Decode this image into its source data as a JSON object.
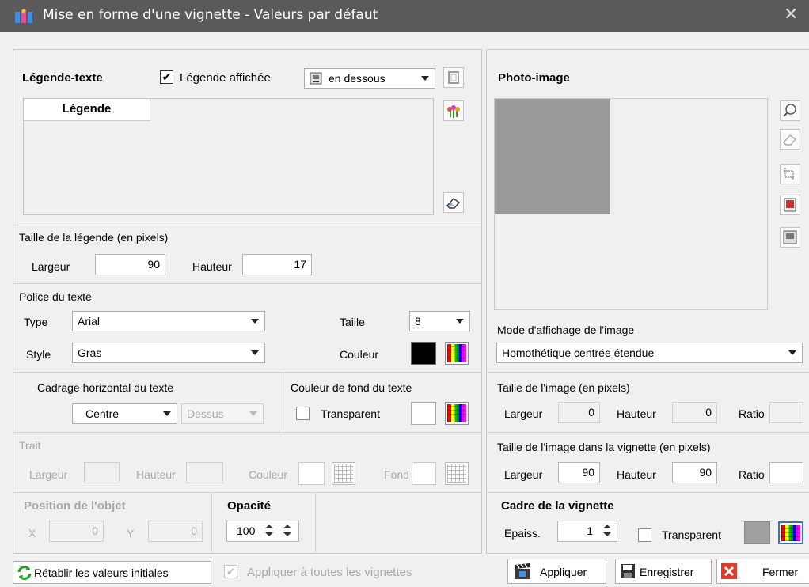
{
  "window": {
    "title": "Mise en forme d'une vignette - Valeurs par défaut",
    "close": "✕"
  },
  "legend": {
    "section_title": "Légende-texte",
    "shown_label": "Légende affichée",
    "shown_checked": true,
    "position_value": "en dessous",
    "text_header": "Légende"
  },
  "legend_size": {
    "title": "Taille de la légende (en pixels)",
    "width_label": "Largeur",
    "width_value": "90",
    "height_label": "Hauteur",
    "height_value": "17"
  },
  "font": {
    "title": "Police du texte",
    "type_label": "Type",
    "type_value": "Arial",
    "size_label": "Taille",
    "size_value": "8",
    "style_label": "Style",
    "style_value": "Gras",
    "color_label": "Couleur",
    "color_value": "#000000"
  },
  "halign": {
    "title": "Cadrage horizontal du texte",
    "h_value": "Centre",
    "v_value": "Dessus"
  },
  "bg": {
    "title": "Couleur de fond du texte",
    "transparent_label": "Transparent"
  },
  "stroke": {
    "title": "Trait",
    "width_label": "Largeur",
    "height_label": "Hauteur",
    "color_label": "Couleur",
    "bg_label": "Fond"
  },
  "position": {
    "title": "Position de l'objet",
    "x_label": "X",
    "x_value": "0",
    "y_label": "Y",
    "y_value": "0"
  },
  "opacity": {
    "title": "Opacité",
    "value": "100"
  },
  "photo": {
    "title": "Photo-image",
    "mode_label": "Mode d'affichage de l'image",
    "mode_value": "Homothétique centrée étendue"
  },
  "image_size": {
    "title": "Taille de l'image (en pixels)",
    "width_label": "Largeur",
    "width_value": "0",
    "height_label": "Hauteur",
    "height_value": "0",
    "ratio_label": "Ratio"
  },
  "image_in_thumb": {
    "title": "Taille de l'image dans la vignette (en pixels)",
    "width_label": "Largeur",
    "width_value": "90",
    "height_label": "Hauteur",
    "height_value": "90",
    "ratio_label": "Ratio"
  },
  "frame": {
    "title": "Cadre de la vignette",
    "thickness_label": "Epaiss.",
    "thickness_value": "1",
    "transparent_label": "Transparent",
    "color_value": "#a0a0a0"
  },
  "footer": {
    "reset_label": "Rétablir les valeurs initiales",
    "apply_all_label": "Appliquer à toutes les vignettes",
    "apply_label": "Appliquer",
    "save_label": "Enregistrer",
    "close_label": "Fermer"
  }
}
